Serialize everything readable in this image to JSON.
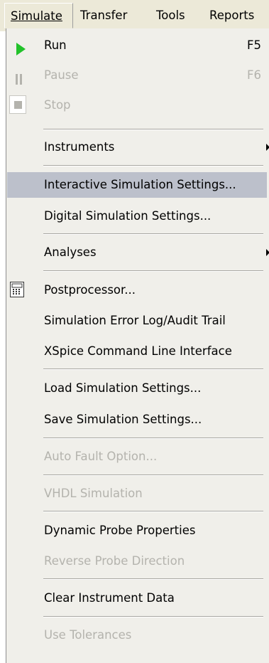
{
  "menubar": {
    "items": [
      "Simulate",
      "Transfer",
      "Tools",
      "Reports"
    ]
  },
  "menu": {
    "items": [
      {
        "label": "Run",
        "shortcut": "F5",
        "icon": "play-icon"
      },
      {
        "label": "Pause",
        "shortcut": "F6",
        "icon": "pause-icon",
        "disabled": true
      },
      {
        "label": "Stop",
        "icon": "stop-icon",
        "disabled": true
      },
      {
        "label": "Instruments",
        "submenu": true
      },
      {
        "label": "Interactive Simulation Settings...",
        "highlighted": true
      },
      {
        "label": "Digital Simulation Settings..."
      },
      {
        "label": "Analyses",
        "submenu": true
      },
      {
        "label": "Postprocessor...",
        "icon": "postprocessor-icon"
      },
      {
        "label": "Simulation Error Log/Audit Trail"
      },
      {
        "label": "XSpice Command Line Interface"
      },
      {
        "label": "Load Simulation Settings..."
      },
      {
        "label": "Save Simulation Settings..."
      },
      {
        "label": "Auto Fault Option...",
        "disabled": true
      },
      {
        "label": "VHDL Simulation",
        "disabled": true
      },
      {
        "label": "Dynamic Probe Properties"
      },
      {
        "label": "Reverse Probe Direction",
        "disabled": true
      },
      {
        "label": "Clear Instrument Data"
      },
      {
        "label": "Use Tolerances",
        "disabled": true
      }
    ]
  },
  "colors": {
    "highlight": "#bcc0cb",
    "disabled_text": "#b4b3ad",
    "run_icon": "#22c22a",
    "menu_background": "#f0efea"
  }
}
